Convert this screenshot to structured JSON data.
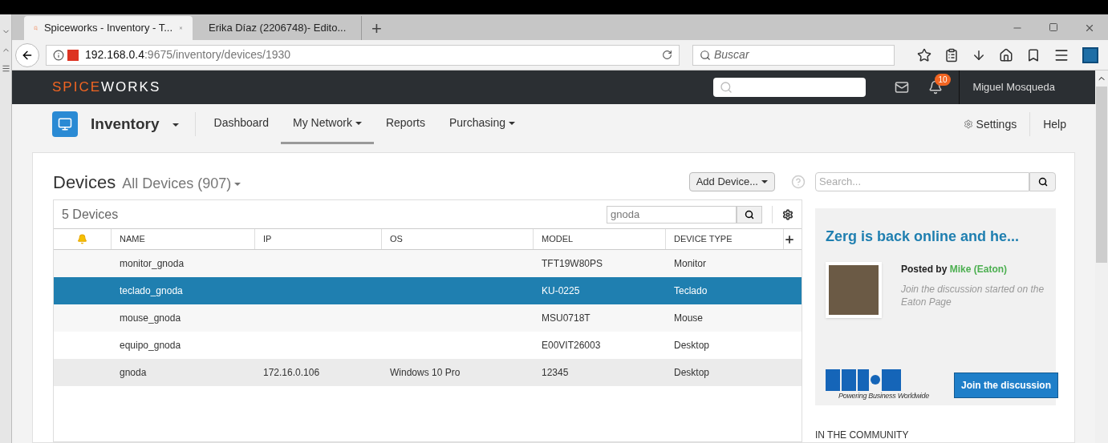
{
  "browser": {
    "tabs": [
      {
        "title": "Spiceworks - Inventory - T...",
        "selected": true
      },
      {
        "title": "Erika Díaz (2206748)- Edito...",
        "selected": false
      }
    ],
    "new_tab": "+",
    "url_host": "192.168.0.4",
    "url_path": ":9675/inventory/devices/1930",
    "search_placeholder": "Buscar"
  },
  "header": {
    "logo_a": "SPICE",
    "logo_b": "WORKS",
    "notifications": "10",
    "user": "Miguel Mosqueda"
  },
  "app_nav": {
    "title": "Inventory",
    "items": [
      {
        "label": "Dashboard",
        "selected": false,
        "has_menu": false
      },
      {
        "label": "My Network",
        "selected": true,
        "has_menu": true
      },
      {
        "label": "Reports",
        "selected": false,
        "has_menu": false
      },
      {
        "label": "Purchasing",
        "selected": false,
        "has_menu": true
      }
    ],
    "settings": "Settings",
    "help": "Help"
  },
  "devices": {
    "title": "Devices",
    "filter": "All Devices (907)",
    "add_button": "Add Device...",
    "count": "5 Devices",
    "search_value": "gnoda",
    "columns": [
      "NAME",
      "IP",
      "OS",
      "MODEL",
      "DEVICE TYPE"
    ],
    "rows": [
      {
        "cells": [
          "monitor_gnoda",
          "",
          "",
          "TFT19W80PS",
          "Monitor"
        ],
        "selected": false,
        "hovered": false
      },
      {
        "cells": [
          "teclado_gnoda",
          "",
          "",
          "KU-0225",
          "Teclado"
        ],
        "selected": true,
        "hovered": false
      },
      {
        "cells": [
          "mouse_gnoda",
          "",
          "",
          "MSU0718T",
          "Mouse"
        ],
        "selected": false,
        "hovered": false
      },
      {
        "cells": [
          "equipo_gnoda",
          "",
          "",
          "E00VIT26003",
          "Desktop"
        ],
        "selected": false,
        "hovered": false
      },
      {
        "cells": [
          "gnoda",
          "172.16.0.106",
          "Windows 10 Pro",
          "12345",
          "Desktop"
        ],
        "selected": false,
        "hovered": true
      }
    ]
  },
  "sidebar": {
    "search_placeholder": "Search...",
    "ad": {
      "title": "Zerg is back online and he...",
      "posted_by": "Posted by",
      "author": "Mike (Eaton)",
      "text": "Join the discussion started on the Eaton Page",
      "tagline": "Powering Business Worldwide",
      "button": "Join the discussion"
    },
    "section": "IN THE COMMUNITY"
  }
}
